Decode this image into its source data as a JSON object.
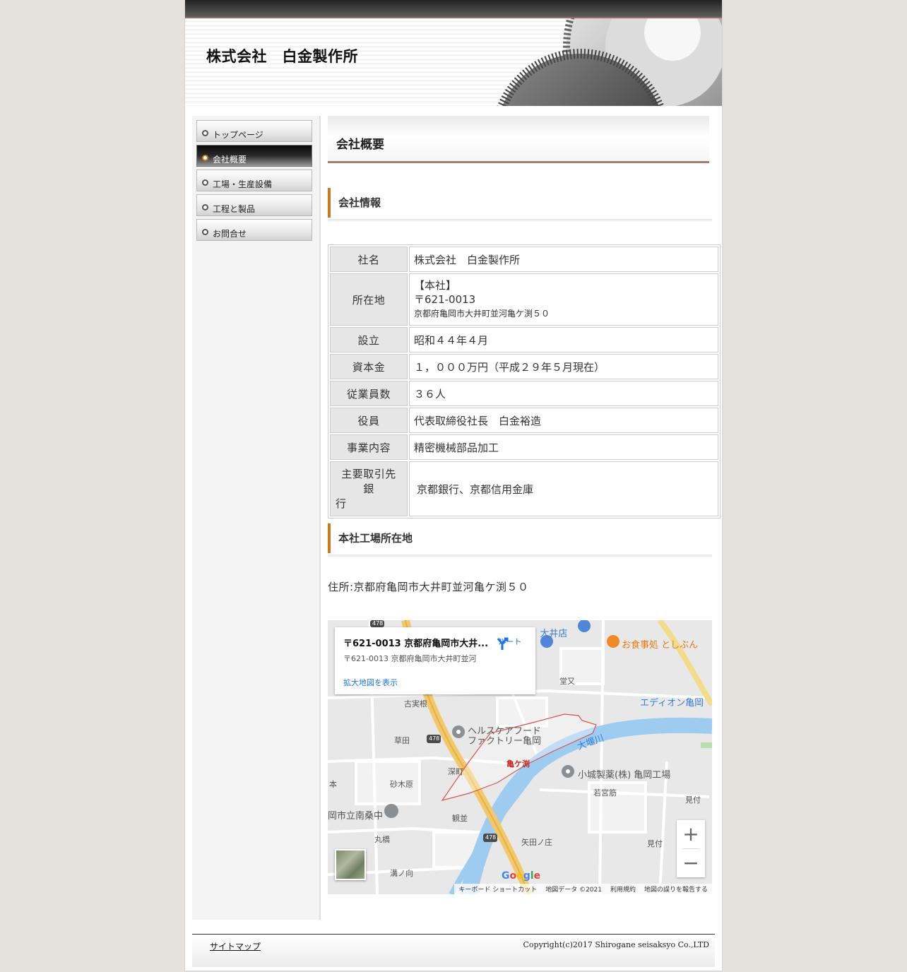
{
  "site": {
    "title": "株式会社　白金製作所"
  },
  "nav": {
    "items": [
      {
        "label": "トップページ",
        "active": false
      },
      {
        "label": "会社概要",
        "active": true
      },
      {
        "label": "工場・生産設備",
        "active": false
      },
      {
        "label": "工程と製品",
        "active": false
      },
      {
        "label": "お問合せ",
        "active": false
      }
    ]
  },
  "main": {
    "title": "会社概要",
    "section1": "会社情報",
    "section2": "本社工場所在地",
    "address_line": "住所:京都府亀岡市大井町並河亀ケ渕５０"
  },
  "company_table": {
    "rows": [
      {
        "key": "社名",
        "value": "株式会社　白金製作所"
      },
      {
        "key": "所在地",
        "value_lines": [
          "【本社】",
          "〒621-0013",
          "京都府亀岡市大井町並河亀ケ渕５０"
        ]
      },
      {
        "key": "設立",
        "value": "昭和４４年４月"
      },
      {
        "key": "資本金",
        "value": "１，０００万円（平成２９年５月現在）"
      },
      {
        "key": "従業員数",
        "value": "３６人"
      },
      {
        "key": "役員",
        "value": "代表取締役社長　白金裕造"
      },
      {
        "key": "事業内容",
        "value": "精密機械部品加工"
      },
      {
        "key_lines": [
          "主要取引先",
          "銀",
          "行"
        ],
        "value": "京都銀行、京都信用金庫"
      }
    ]
  },
  "map": {
    "card_title": "〒621-0013 京都府亀岡市大井...",
    "card_address": "〒621-0013 京都府亀岡市大井町並河",
    "enlarge_link": "拡大地図を表示",
    "route_label": "ルート",
    "zoom_in": "+",
    "zoom_out": "−",
    "footer": {
      "shortcuts": "キーボード ショートカット",
      "data": "地図データ ©2021",
      "terms": "利用規約",
      "report": "地図の誤りを報告する"
    },
    "labels": {
      "coop": "コープエフ 大井店",
      "restaurant": "お食事処 としぶん",
      "doumata": "堂又",
      "edion": "エディオン亀岡",
      "kosane": "古実根",
      "health1": "ヘルスケアフード",
      "health2": "ファクトリー亀岡",
      "kusada": "草田",
      "fukamachi": "深町",
      "kamegafuchi": "亀ケ渕",
      "oizekawa": "大堰川",
      "shiro": "小城製薬(株) 亀岡工場",
      "sunaki": "砂木原",
      "wakamiya": "若宮筋",
      "mitsuke1": "見付",
      "school": "岡市立南桑中",
      "kannami": "観並",
      "maruhashi": "丸橋",
      "yatanosho": "矢田ノ庄",
      "mitsuke2": "見付",
      "mizonomukai": "溝ノ向",
      "moto": "本",
      "route478": "478"
    }
  },
  "footer": {
    "sitemap": "サイトマップ",
    "copyright": "Copyright(c)2017 Shirogane seisaksyo Co.,LTD"
  }
}
